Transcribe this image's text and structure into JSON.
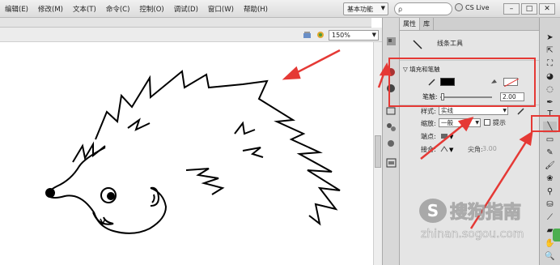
{
  "menu": [
    "编辑(E)",
    "修改(M)",
    "文本(T)",
    "命令(C)",
    "控制(O)",
    "调试(D)",
    "窗口(W)",
    "帮助(H)"
  ],
  "workspace": {
    "label": "基本功能",
    "arrow": "▼"
  },
  "search": {
    "icon": "🔍",
    "value": "ρ"
  },
  "cs_live": "CS Live",
  "window_buttons": [
    "–",
    "□",
    "✕"
  ],
  "zoom": {
    "value": "150%",
    "arrow": "▼"
  },
  "panel": {
    "tabs": [
      "属性",
      "库"
    ],
    "tool_name": "线条工具",
    "section": "填充和笔触",
    "stroke_label": "笔触:",
    "stroke_value": "2.00",
    "style_label": "样式:",
    "style_value": "实线",
    "scale_label": "缩放:",
    "scale_value": "一般",
    "hint_label": "提示",
    "cap_label": "端点:",
    "join_label": "接合:",
    "miter_label": "尖角:",
    "miter_value": "3.00"
  },
  "watermark": {
    "logo": "S",
    "text": "搜狗指南",
    "url": "zhinan.sogou.com"
  },
  "colors": {
    "stroke": "#000000",
    "annotation": "#e53935"
  }
}
